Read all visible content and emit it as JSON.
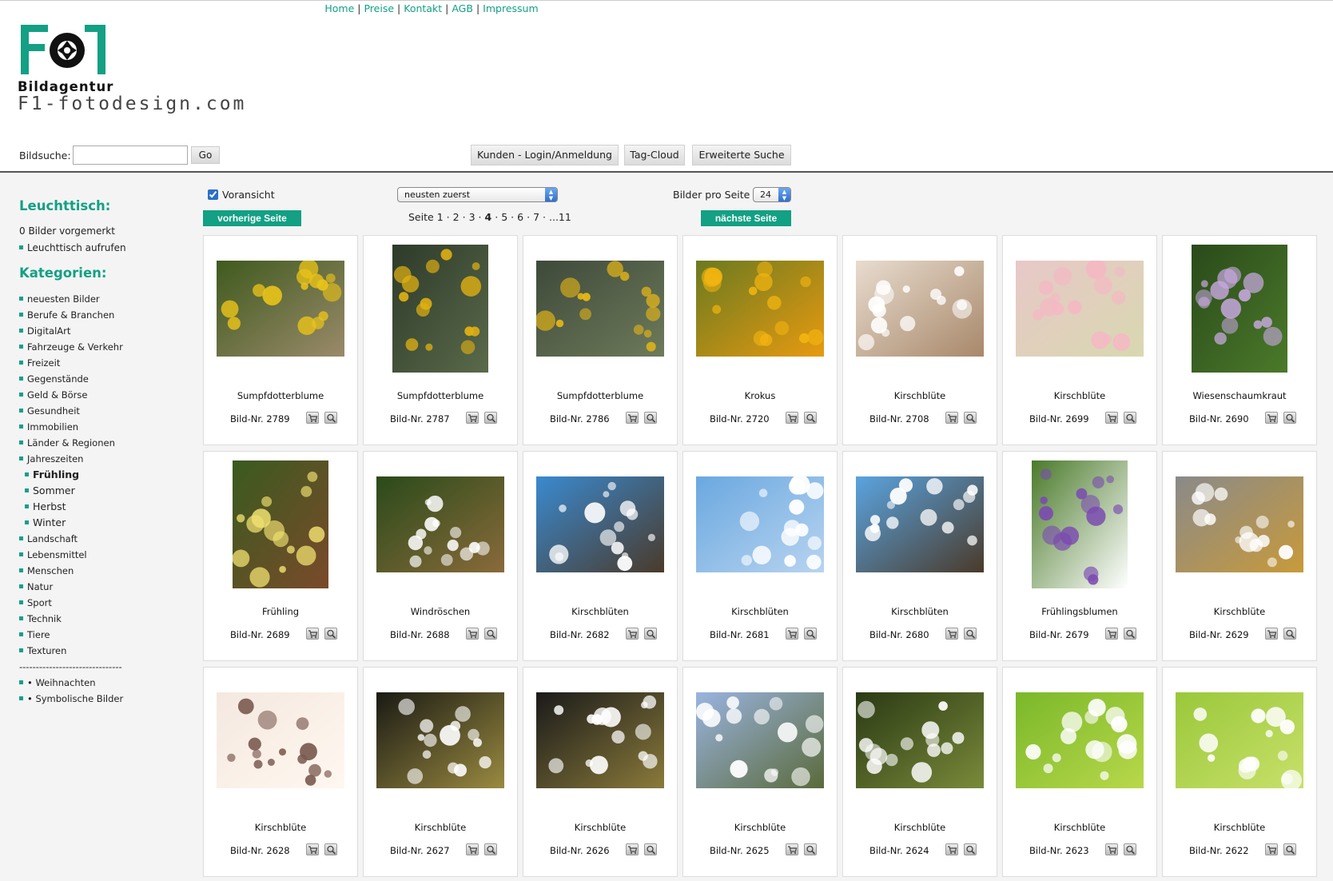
{
  "topnav": {
    "items": [
      "Home",
      "Preise",
      "Kontakt",
      "AGB",
      "Impressum"
    ]
  },
  "logo": {
    "mark_text": "F1",
    "agency": "Bildagentur",
    "domain": "F1-fotodesign.com"
  },
  "search": {
    "label": "Bildsuche:",
    "value": "",
    "go": "Go"
  },
  "header_buttons": {
    "login": "Kunden - Login/Anmeldung",
    "tagcloud": "Tag-Cloud",
    "erweitert": "Erweiterte Suche"
  },
  "leuchttisch": {
    "heading": "Leuchttisch:",
    "count": "0 Bilder vorgemerkt",
    "open": "Leuchttisch aufrufen"
  },
  "kategorien": {
    "heading": "Kategorien:",
    "items": [
      {
        "label": "neuesten Bilder"
      },
      {
        "label": "Berufe & Branchen"
      },
      {
        "label": "DigitalArt"
      },
      {
        "label": "Fahrzeuge & Verkehr"
      },
      {
        "label": "Freizeit"
      },
      {
        "label": "Gegenstände"
      },
      {
        "label": "Geld & Börse"
      },
      {
        "label": "Gesundheit"
      },
      {
        "label": "Immobilien"
      },
      {
        "label": "Länder & Regionen"
      },
      {
        "label": "Jahreszeiten"
      },
      {
        "label": "Frühling",
        "sub": true,
        "active": true
      },
      {
        "label": "Sommer",
        "sub": true
      },
      {
        "label": "Herbst",
        "sub": true
      },
      {
        "label": "Winter",
        "sub": true
      },
      {
        "label": "Landschaft"
      },
      {
        "label": "Lebensmittel"
      },
      {
        "label": "Menschen"
      },
      {
        "label": "Natur"
      },
      {
        "label": "Sport"
      },
      {
        "label": "Technik"
      },
      {
        "label": "Tiere"
      },
      {
        "label": "Texturen"
      },
      {
        "label": "-------------------------------",
        "nobullet": true
      },
      {
        "label": "• Weihnachten"
      },
      {
        "label": "• Symbolische Bilder"
      }
    ]
  },
  "controls": {
    "preview_label": "Voransicht",
    "preview_checked": true,
    "sort_value": "neusten zuerst",
    "perpage_label": "Bilder pro Seite",
    "perpage_value": "24",
    "prev": "vorherige Seite",
    "next": "nächste Seite"
  },
  "pager": {
    "label": "Seite",
    "pages": [
      "1",
      "2",
      "3",
      "4",
      "5",
      "6",
      "7"
    ],
    "current": "4",
    "last": "...11"
  },
  "colors": {
    "accent": "#13a084",
    "cart_icon": "cart-icon",
    "zoom_icon": "magnifier-icon"
  },
  "images": [
    {
      "title": "Sumpfdotterblume",
      "nr": "Bild-Nr. 2789",
      "orient": "landscape",
      "palette": [
        "#3f5a1e",
        "#e8c21a",
        "#9a8a6a"
      ]
    },
    {
      "title": "Sumpfdotterblume",
      "nr": "Bild-Nr. 2787",
      "orient": "portrait",
      "palette": [
        "#2d3a2a",
        "#e0b012",
        "#5a6a4a"
      ]
    },
    {
      "title": "Sumpfdotterblume",
      "nr": "Bild-Nr. 2786",
      "orient": "landscape",
      "palette": [
        "#3e4a3a",
        "#e8b816",
        "#6e7a5a"
      ]
    },
    {
      "title": "Krokus",
      "nr": "Bild-Nr. 2720",
      "orient": "landscape",
      "palette": [
        "#6a7a20",
        "#f2b410",
        "#e89a10"
      ]
    },
    {
      "title": "Kirschblüte",
      "nr": "Bild-Nr. 2708",
      "orient": "landscape",
      "palette": [
        "#e8dccf",
        "#ffffff",
        "#a8886a"
      ]
    },
    {
      "title": "Kirschblüte",
      "nr": "Bild-Nr. 2699",
      "orient": "landscape",
      "palette": [
        "#e8c8c8",
        "#f4b8c4",
        "#d8d8b0"
      ]
    },
    {
      "title": "Wiesenschaumkraut",
      "nr": "Bild-Nr. 2690",
      "orient": "portrait",
      "palette": [
        "#2a4a1a",
        "#c8a8e0",
        "#4a7a2a"
      ]
    },
    {
      "title": "Frühling",
      "nr": "Bild-Nr. 2689",
      "orient": "portrait",
      "palette": [
        "#3a5a20",
        "#f0e070",
        "#7a4a2a"
      ]
    },
    {
      "title": "Windröschen",
      "nr": "Bild-Nr. 2688",
      "orient": "landscape",
      "palette": [
        "#2a4a1a",
        "#ffffff",
        "#8a6a3a"
      ]
    },
    {
      "title": "Kirschblüten",
      "nr": "Bild-Nr. 2682",
      "orient": "landscape",
      "palette": [
        "#3a8ad0",
        "#ffffff",
        "#4a3a2a"
      ]
    },
    {
      "title": "Kirschblüten",
      "nr": "Bild-Nr. 2681",
      "orient": "landscape",
      "palette": [
        "#6aa8e0",
        "#ffffff",
        "#b8d4f0"
      ]
    },
    {
      "title": "Kirschblüten",
      "nr": "Bild-Nr. 2680",
      "orient": "landscape",
      "palette": [
        "#5aa4e0",
        "#ffffff",
        "#4a3a2a"
      ]
    },
    {
      "title": "Frühlingsblumen",
      "nr": "Bild-Nr. 2679",
      "orient": "portrait",
      "palette": [
        "#4a7a2a",
        "#7a4ab0",
        "#ffffff"
      ]
    },
    {
      "title": "Kirschblüte",
      "nr": "Bild-Nr. 2629",
      "orient": "landscape",
      "palette": [
        "#8a8a8a",
        "#ffffff",
        "#c89a3a"
      ]
    },
    {
      "title": "Kirschblüte",
      "nr": "Bild-Nr. 2628",
      "orient": "landscape",
      "palette": [
        "#f4e8e0",
        "#7a5a50",
        "#fff8f0"
      ]
    },
    {
      "title": "Kirschblüte",
      "nr": "Bild-Nr. 2627",
      "orient": "landscape",
      "palette": [
        "#1a1a14",
        "#ffffff",
        "#9a8a40"
      ]
    },
    {
      "title": "Kirschblüte",
      "nr": "Bild-Nr. 2626",
      "orient": "landscape",
      "palette": [
        "#1a1a1a",
        "#ffffff",
        "#8a7a3a"
      ]
    },
    {
      "title": "Kirschblüte",
      "nr": "Bild-Nr. 2625",
      "orient": "landscape",
      "palette": [
        "#9ab4e0",
        "#ffffff",
        "#5a6a3a"
      ]
    },
    {
      "title": "Kirschblüte",
      "nr": "Bild-Nr. 2624",
      "orient": "landscape",
      "palette": [
        "#2a3a14",
        "#ffffff",
        "#7a8a3a"
      ]
    },
    {
      "title": "Kirschblüte",
      "nr": "Bild-Nr. 2623",
      "orient": "landscape",
      "palette": [
        "#7ab82a",
        "#ffffff",
        "#b8d84a"
      ]
    },
    {
      "title": "Kirschblüte",
      "nr": "Bild-Nr. 2622",
      "orient": "landscape",
      "palette": [
        "#9ac83a",
        "#ffffff",
        "#c8e06a"
      ]
    }
  ]
}
